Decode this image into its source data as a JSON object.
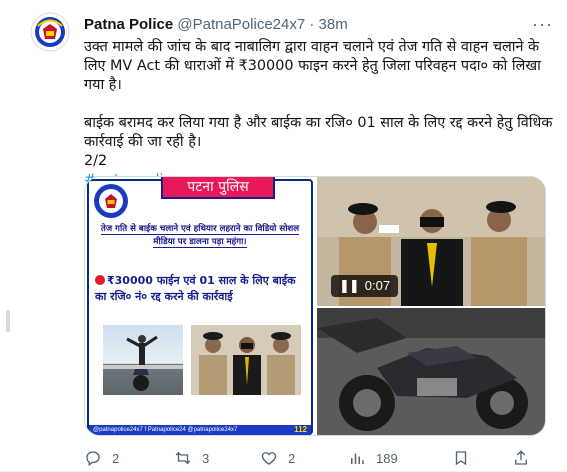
{
  "tweet": {
    "author_name": "Patna Police",
    "handle": "@PatnaPolice24x7",
    "separator": "·",
    "time": "38m",
    "more_label": "···",
    "body_para1": "उक्त मामले की जांच के बाद नाबालिग द्वारा वाहन चलाने एवं तेज गति से वाहन चलाने के लिए MV Act की धाराओं में ₹30000 फाइन करने हेतु जिला परिवहन पदा० को लिखा गया है।",
    "body_para2": "बाईक बरामद कर लिया गया है और बाईक का रजि० 01 साल के लिए रद्द करने हेतु विधिक कार्रवाई की जा रही है।",
    "thread_count": "2/2",
    "hashtag": "#patnapolice"
  },
  "media": {
    "poster_banner": "पटना पुलिस",
    "poster_headline": "तेज गति से बाईक चलाने एवं हथियार लहराने का विडियो सोशल मीडिया पर डालना पड़ा महंगा।",
    "poster_fine_text": "₹30000 फाईन एवं 01 साल के लिए बाईक का रजि० नं० रद्द करने की कार्रवाई",
    "poster_footer": "@patnapolice24x7 f Patnapolice24 @patnapolice24x7",
    "poster_footer_num": "112",
    "video_duration": "0:07",
    "video_control_icon": "pause-icon"
  },
  "actions": {
    "replies": "2",
    "retweets": "3",
    "likes": "2",
    "views": "189"
  },
  "colors": {
    "accent": "#1d9bf0",
    "muted": "#536471",
    "poster_blue": "#1a1a8a",
    "poster_pink": "#e8185a"
  }
}
